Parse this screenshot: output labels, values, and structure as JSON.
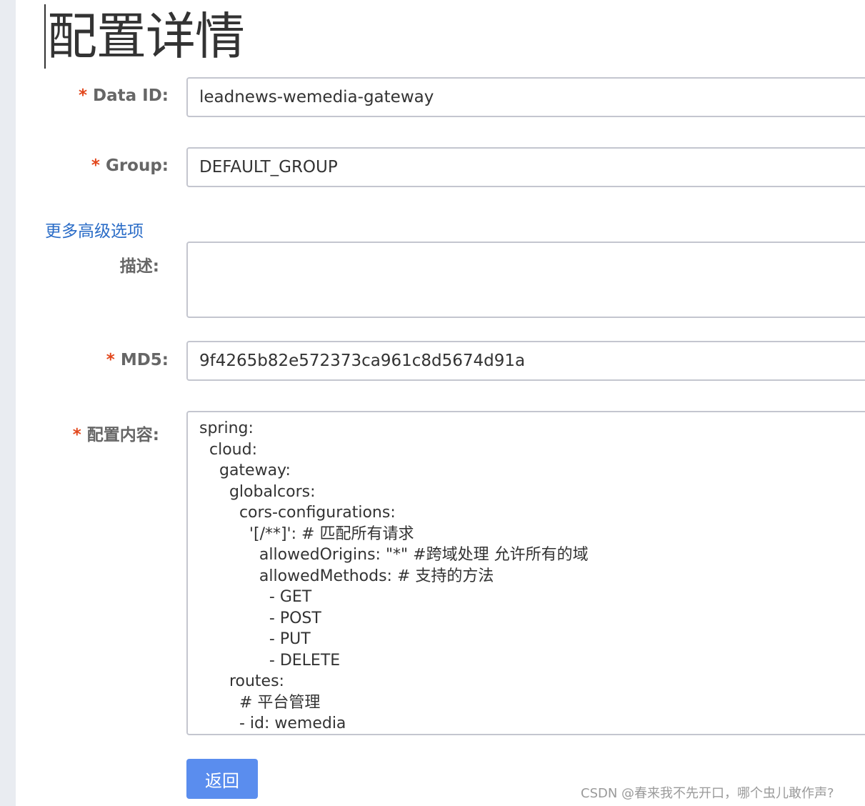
{
  "page_title": "配置详情",
  "form": {
    "data_id": {
      "required_mark": "*",
      "label": "Data ID:",
      "value": "leadnews-wemedia-gateway"
    },
    "group": {
      "required_mark": "*",
      "label": "Group:",
      "value": "DEFAULT_GROUP"
    },
    "advanced_link": "更多高级选项",
    "description": {
      "label": "描述:",
      "value": ""
    },
    "md5": {
      "required_mark": "*",
      "label": "MD5:",
      "value": "9f4265b82e572373ca961c8d5674d91a"
    },
    "content": {
      "required_mark": "*",
      "label": "配置内容:",
      "lines": [
        "spring:",
        "  cloud:",
        "    gateway:",
        "      globalcors:",
        "        cors-configurations:",
        "          '[/**]': # 匹配所有请求",
        "            allowedOrigins: \"*\" #跨域处理 允许所有的域",
        "            allowedMethods: # 支持的方法",
        "              - GET",
        "              - POST",
        "              - PUT",
        "              - DELETE",
        "      routes:",
        "        # 平台管理",
        "        - id: wemedia"
      ]
    }
  },
  "back_button": "返回",
  "watermark": "CSDN @春来我不先开口，哪个虫儿敢作声?"
}
